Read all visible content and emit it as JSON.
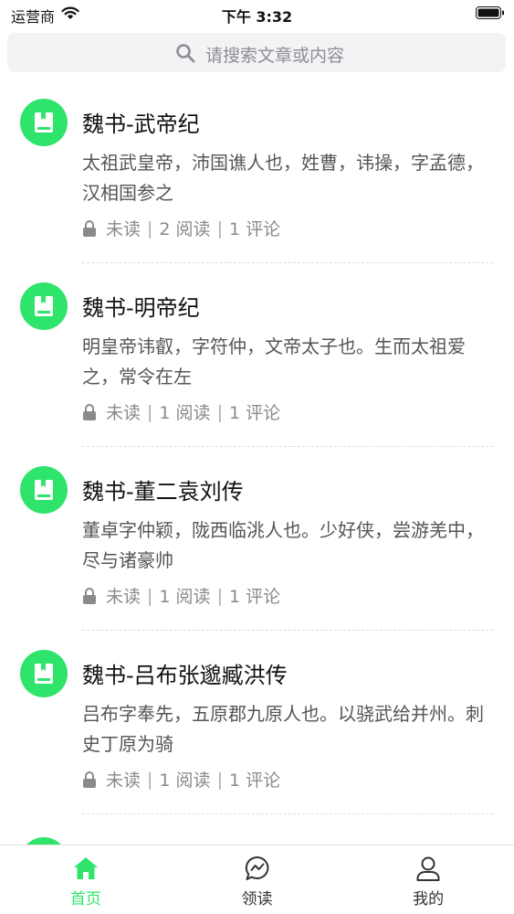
{
  "status_bar": {
    "carrier": "运营商",
    "time": "下午 3:32"
  },
  "search": {
    "placeholder": "请搜索文章或内容"
  },
  "articles": [
    {
      "title": "魏书-武帝纪",
      "excerpt": "太祖武皇帝，沛国谯人也，姓曹，讳操，字孟德，汉相国参之",
      "status": "未读",
      "reads": "2 阅读",
      "comments": "1 评论"
    },
    {
      "title": "魏书-明帝纪",
      "excerpt": "明皇帝讳叡，字符仲，文帝太子也。生而太祖爱之，常令在左",
      "status": "未读",
      "reads": "1 阅读",
      "comments": "1 评论"
    },
    {
      "title": "魏书-董二袁刘传",
      "excerpt": "董卓字仲颖，陇西临洮人也。少好侠，尝游羌中，尽与诸豪帅",
      "status": "未读",
      "reads": "1 阅读",
      "comments": "1 评论"
    },
    {
      "title": "魏书-吕布张邈臧洪传",
      "excerpt": "吕布字奉先，五原郡九原人也。以骁武给并州。刺史丁原为骑",
      "status": "未读",
      "reads": "1 阅读",
      "comments": "1 评论"
    }
  ],
  "tabs": [
    {
      "label": "首页",
      "icon": "home-icon",
      "active": true
    },
    {
      "label": "领读",
      "icon": "chat-icon",
      "active": false
    },
    {
      "label": "我的",
      "icon": "person-icon",
      "active": false
    }
  ],
  "colors": {
    "accent": "#2fe46b",
    "text": "#111111",
    "muted": "#8a8a8a"
  }
}
